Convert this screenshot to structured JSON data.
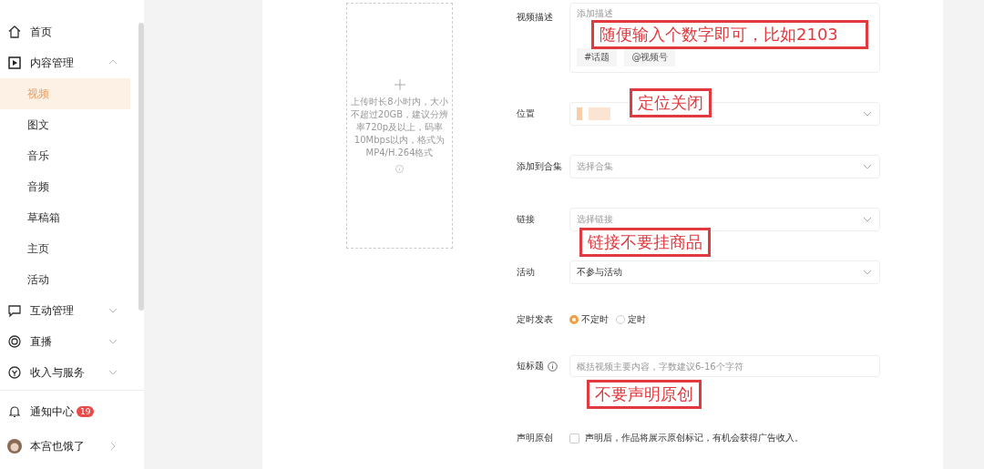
{
  "sidebar": {
    "items": [
      {
        "label": "首页",
        "kind": "link",
        "selected": false
      },
      {
        "label": "内容管理",
        "kind": "group",
        "expanded": true,
        "selected": false,
        "children": [
          {
            "label": "视频",
            "selected": true
          },
          {
            "label": "图文",
            "selected": false
          },
          {
            "label": "音乐",
            "selected": false
          },
          {
            "label": "音频",
            "selected": false
          },
          {
            "label": "草稿箱",
            "selected": false
          },
          {
            "label": "主页",
            "selected": false
          },
          {
            "label": "活动",
            "selected": false
          }
        ]
      },
      {
        "label": "互动管理",
        "kind": "group",
        "expanded": false,
        "selected": false
      },
      {
        "label": "直播",
        "kind": "group",
        "expanded": false,
        "selected": false
      },
      {
        "label": "收入与服务",
        "kind": "group",
        "expanded": false,
        "selected": false
      }
    ],
    "notifications": {
      "label": "通知中心",
      "badge": "19"
    },
    "user": {
      "name": "本宫也饿了"
    }
  },
  "upload": {
    "hint": "上传时长8小时内，大小不超过20GB，建议分辨率720p及以上，码率10Mbps以内，格式为MP4/H.264格式"
  },
  "form": {
    "description": {
      "label": "视频描述",
      "placeholder": "添加描述",
      "tags": [
        "#话题",
        "@视频号"
      ]
    },
    "location": {
      "label": "位置"
    },
    "collection": {
      "label": "添加到合集",
      "placeholder": "选择合集"
    },
    "link": {
      "label": "链接",
      "placeholder": "选择链接"
    },
    "activity": {
      "label": "活动",
      "value": "不参与活动"
    },
    "schedule": {
      "label": "定时发表",
      "options": [
        {
          "label": "不定时",
          "selected": true
        },
        {
          "label": "定时",
          "selected": false
        }
      ]
    },
    "short_title": {
      "label": "短标题",
      "placeholder": "概括视频主要内容，字数建议6-16个字符"
    },
    "original": {
      "label": "声明原创",
      "checked": false,
      "text": "声明后，作品将展示原创标记，有机会获得广告收入。"
    }
  },
  "annotations": [
    {
      "text": "随便输入个数字即可，比如2103"
    },
    {
      "text": "定位关闭"
    },
    {
      "text": "链接不要挂商品"
    },
    {
      "text": "不要声明原创"
    }
  ]
}
